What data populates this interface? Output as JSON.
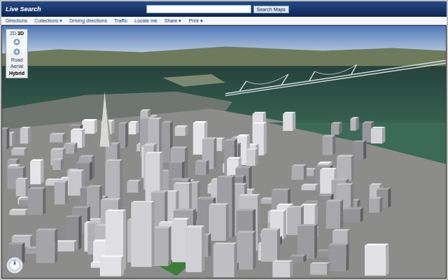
{
  "window": {
    "title": "Live Search"
  },
  "search": {
    "button": "Search Maps"
  },
  "menu": [
    "Directions",
    "Collections ▾",
    "Driving directions",
    "Traffic",
    "Locate me",
    "Share ▾",
    "Print ▾"
  ],
  "view_control": {
    "modes": [
      {
        "label": "2D",
        "selected": false
      },
      {
        "label": "3D",
        "selected": true
      }
    ],
    "styles": [
      {
        "label": "Road",
        "selected": false
      },
      {
        "label": "Aerial",
        "selected": false
      },
      {
        "label": "Hybrid",
        "selected": true
      }
    ]
  }
}
